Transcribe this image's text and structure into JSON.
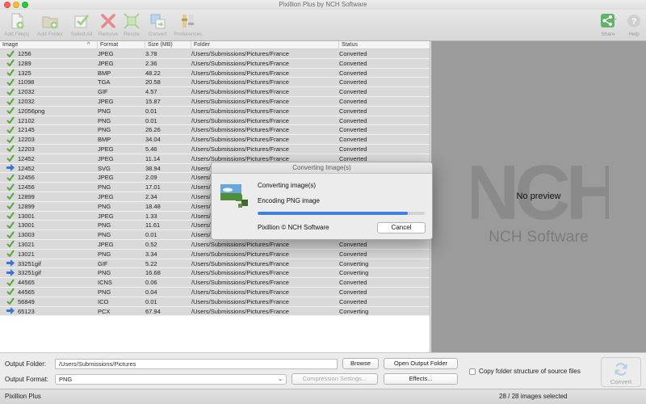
{
  "window": {
    "title": "Pixillion Plus by NCH Software"
  },
  "toolbar": {
    "items": [
      {
        "label": "Add File(s)",
        "icon": "add-file-icon"
      },
      {
        "label": "Add Folder",
        "icon": "add-folder-icon"
      },
      {
        "label": "Select All",
        "icon": "select-all-icon"
      },
      {
        "label": "Remove",
        "icon": "remove-icon"
      },
      {
        "label": "Resize",
        "icon": "resize-icon"
      },
      {
        "label": "Convert",
        "icon": "convert-icon"
      },
      {
        "label": "Preferences",
        "icon": "preferences-icon"
      }
    ],
    "share_label": "Share",
    "help_label": "Help"
  },
  "table": {
    "headers": {
      "image": "Image",
      "format": "Format",
      "size": "Size (MB)",
      "folder": "Folder",
      "status": "Status"
    },
    "rows": [
      {
        "name": "1256",
        "format": "JPEG",
        "size": "3.78",
        "folder": "/Users/Submissions/Pictures/France",
        "status": "Converted",
        "state": "done"
      },
      {
        "name": "1289",
        "format": "JPEG",
        "size": "2.36",
        "folder": "/Users/Submissions/Pictures/France",
        "status": "Converted",
        "state": "done"
      },
      {
        "name": "1325",
        "format": "BMP",
        "size": "48.22",
        "folder": "/Users/Submissions/Pictures/France",
        "status": "Converted",
        "state": "done"
      },
      {
        "name": "11098",
        "format": "TGA",
        "size": "20.58",
        "folder": "/Users/Submissions/Pictures/France",
        "status": "Converted",
        "state": "done"
      },
      {
        "name": "12032",
        "format": "GIF",
        "size": "4.57",
        "folder": "/Users/Submissions/Pictures/France",
        "status": "Converted",
        "state": "done"
      },
      {
        "name": "12032",
        "format": "JPEG",
        "size": "15.87",
        "folder": "/Users/Submissions/Pictures/France",
        "status": "Converted",
        "state": "done"
      },
      {
        "name": "12056png",
        "format": "PNG",
        "size": "0.01",
        "folder": "/Users/Submissions/Pictures/France",
        "status": "Converted",
        "state": "done"
      },
      {
        "name": "12102",
        "format": "PNG",
        "size": "0.01",
        "folder": "/Users/Submissions/Pictures/France",
        "status": "Converted",
        "state": "done"
      },
      {
        "name": "12145",
        "format": "PNG",
        "size": "26.26",
        "folder": "/Users/Submissions/Pictures/France",
        "status": "Converted",
        "state": "done"
      },
      {
        "name": "12203",
        "format": "BMP",
        "size": "34.04",
        "folder": "/Users/Submissions/Pictures/France",
        "status": "Converted",
        "state": "done"
      },
      {
        "name": "12203",
        "format": "JPEG",
        "size": "5.46",
        "folder": "/Users/Submissions/Pictures/France",
        "status": "Converted",
        "state": "done"
      },
      {
        "name": "12452",
        "format": "JPEG",
        "size": "11.14",
        "folder": "/Users/Submissions/Pictures/France",
        "status": "Converted",
        "state": "done"
      },
      {
        "name": "12452",
        "format": "SVG",
        "size": "38.94",
        "folder": "/Users/",
        "status": "",
        "state": "pending"
      },
      {
        "name": "12456",
        "format": "JPEG",
        "size": "2.09",
        "folder": "/Users/",
        "status": "",
        "state": "done"
      },
      {
        "name": "12456",
        "format": "PNG",
        "size": "17.01",
        "folder": "/Users/",
        "status": "",
        "state": "done"
      },
      {
        "name": "12899",
        "format": "JPEG",
        "size": "2.34",
        "folder": "/Users/",
        "status": "",
        "state": "done"
      },
      {
        "name": "12899",
        "format": "PNG",
        "size": "18.48",
        "folder": "/Users/",
        "status": "",
        "state": "done"
      },
      {
        "name": "13001",
        "format": "JPEG",
        "size": "1.33",
        "folder": "/Users/",
        "status": "",
        "state": "done"
      },
      {
        "name": "13001",
        "format": "PNG",
        "size": "11.61",
        "folder": "/Users/",
        "status": "",
        "state": "done"
      },
      {
        "name": "13003",
        "format": "PNG",
        "size": "0.01",
        "folder": "/Users/",
        "status": "",
        "state": "done"
      },
      {
        "name": "13021",
        "format": "JPEG",
        "size": "0.52",
        "folder": "/Users/Submissions/Pictures/France",
        "status": "Converted",
        "state": "done"
      },
      {
        "name": "13021",
        "format": "PNG",
        "size": "3.34",
        "folder": "/Users/Submissions/Pictures/France",
        "status": "Converted",
        "state": "done"
      },
      {
        "name": "33251gif",
        "format": "GIF",
        "size": "5.22",
        "folder": "/Users/Submissions/Pictures/France",
        "status": "Converting",
        "state": "pending"
      },
      {
        "name": "33251gif",
        "format": "PNG",
        "size": "16.68",
        "folder": "/Users/Submissions/Pictures/France",
        "status": "Converting",
        "state": "pending"
      },
      {
        "name": "44565",
        "format": "ICNS",
        "size": "0.06",
        "folder": "/Users/Submissions/Pictures/France",
        "status": "Converted",
        "state": "done"
      },
      {
        "name": "44565",
        "format": "PNG",
        "size": "0.04",
        "folder": "/Users/Submissions/Pictures/France",
        "status": "Converted",
        "state": "done"
      },
      {
        "name": "56849",
        "format": "ICO",
        "size": "0.01",
        "folder": "/Users/Submissions/Pictures/France",
        "status": "Converted",
        "state": "done"
      },
      {
        "name": "65123",
        "format": "PCX",
        "size": "67.94",
        "folder": "/Users/Submissions/Pictures/France",
        "status": "Converting",
        "state": "pending"
      }
    ]
  },
  "preview": {
    "text": "No preview",
    "logo_letters": "NCH",
    "company": "NCH Software"
  },
  "bottom": {
    "output_folder_label": "Output Folder:",
    "output_folder_value": "/Users/Submissions/Pictures",
    "browse_label": "Browse",
    "open_output_label": "Open Output Folder",
    "output_format_label": "Output Format:",
    "output_format_value": "PNG",
    "compression_label": "Compression Settings...",
    "effects_label": "Effects...",
    "copy_structure_label": "Copy folder structure of source files",
    "convert_label": "Convert"
  },
  "statusbar": {
    "app_name": "Pixillion Plus",
    "selection": "28 / 28 images selected"
  },
  "modal": {
    "title": "Converting Image(s)",
    "line1": "Converting image(s)",
    "line2": "Encoding PNG image",
    "progress": 0.9,
    "copyright": "Pixillion © NCH Software",
    "cancel_label": "Cancel"
  },
  "colors": {
    "accent": "#3f7fdc",
    "check_green": "#5aa63a",
    "arrow_blue": "#3a74d6",
    "remove_red": "#d8414a"
  }
}
